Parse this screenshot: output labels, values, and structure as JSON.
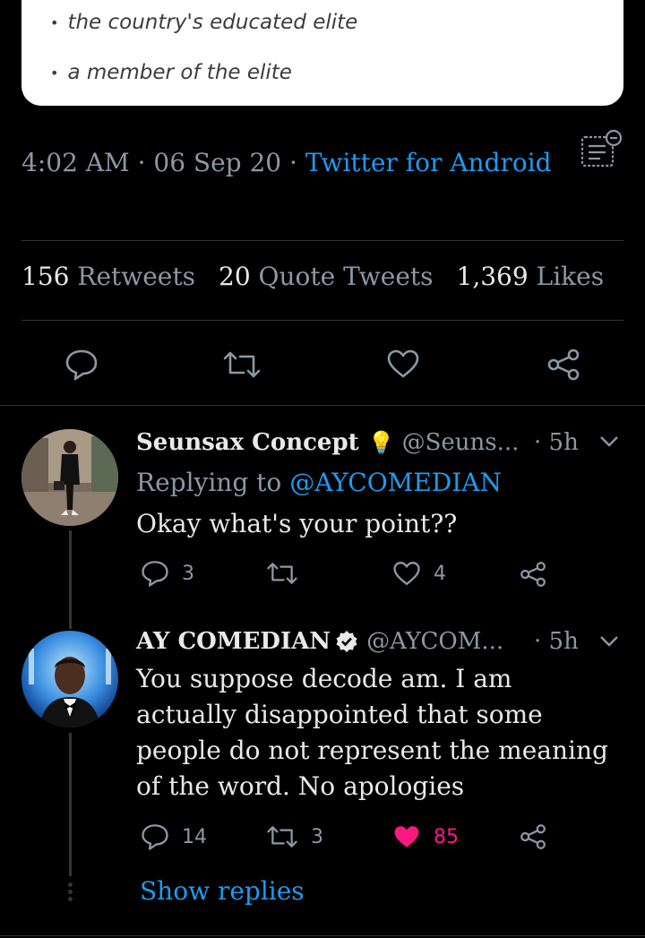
{
  "quoted_card": {
    "items": [
      "the country's educated elite",
      "a member of the elite"
    ]
  },
  "tweet": {
    "time": "4:02 AM",
    "date": "06 Sep 20",
    "source": "Twitter for Android",
    "stats": {
      "retweets_count": "156",
      "retweets_label": "Retweets",
      "quotes_count": "20",
      "quotes_label": "Quote Tweets",
      "likes_count": "1,369",
      "likes_label": "Likes"
    }
  },
  "replies": [
    {
      "name": "Seunsax Concept",
      "name_emoji": "💡",
      "handle": "@Seuns...",
      "time": "5h",
      "replying_prefix": "Replying to",
      "replying_to": "@AYCOMEDIAN",
      "text": "Okay what's your point??",
      "reply_count": "3",
      "retweet_count": "",
      "like_count": "4"
    },
    {
      "name": "AY COMEDIAN",
      "verified": true,
      "handle": "@AYCOM...",
      "time": "5h",
      "text": "You suppose decode am. I am actually disappointed that some people do not represent the meaning of the word. No apologies",
      "reply_count": "14",
      "retweet_count": "3",
      "like_count": "85",
      "liked": true
    }
  ],
  "show_replies": "Show replies",
  "colors": {
    "accent": "#1d9bf0",
    "like": "#f91880",
    "muted": "#8b98a5",
    "background": "#000000"
  }
}
